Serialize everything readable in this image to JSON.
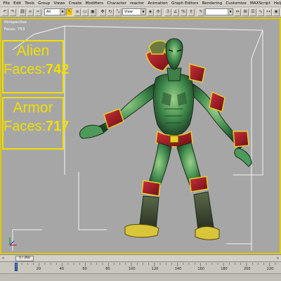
{
  "menu": [
    "File",
    "Edit",
    "Tools",
    "Group",
    "Views",
    "Create",
    "Modifiers",
    "Character",
    "reactor",
    "Animation",
    "Graph Editors",
    "Rendering",
    "Customize",
    "MAXScript",
    "Help"
  ],
  "toolbar": {
    "selection_filter": "All",
    "reference_coord": "View",
    "active_tool": "select-object-icon"
  },
  "viewport": {
    "label": "Perspective",
    "faces_readout": "Faces: 753",
    "border_color": "#e0c800"
  },
  "overlays": [
    {
      "name": "Alien",
      "faces_label": "Faces:",
      "faces_value": "742"
    },
    {
      "name": "Armor",
      "faces_label": "Faces:",
      "faces_value": "717"
    }
  ],
  "overlay_color": "#f0e000",
  "timeslider": {
    "frame_label": "0 / 260",
    "prev_arrow": "<",
    "next_arrow": ">"
  },
  "trackbar": {
    "ticks": [
      "0",
      "20",
      "40",
      "60",
      "80",
      "100",
      "120",
      "140",
      "160",
      "180",
      "200",
      "220"
    ]
  }
}
